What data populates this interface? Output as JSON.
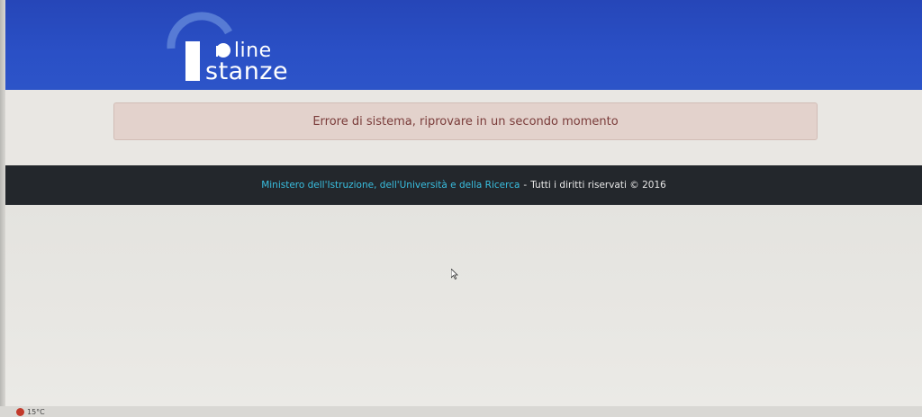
{
  "header": {
    "logo_line1": "n line",
    "logo_line2": "stanze"
  },
  "alert": {
    "message": "Errore di sistema, riprovare in un secondo momento"
  },
  "footer": {
    "ministry_link": "Ministero dell'Istruzione, dell'Università e della Ricerca",
    "separator": "-",
    "rights": "Tutti i diritti riservati © 2016"
  },
  "taskbar": {
    "temperature": "15°C",
    "weather_icon": "weather-alert-icon"
  },
  "colors": {
    "header_blue": "#2a50c6",
    "footer_dark": "#23272c",
    "link_cyan": "#39bfe0",
    "alert_bg": "#e3d2cc",
    "alert_text": "#7a3c3a"
  }
}
